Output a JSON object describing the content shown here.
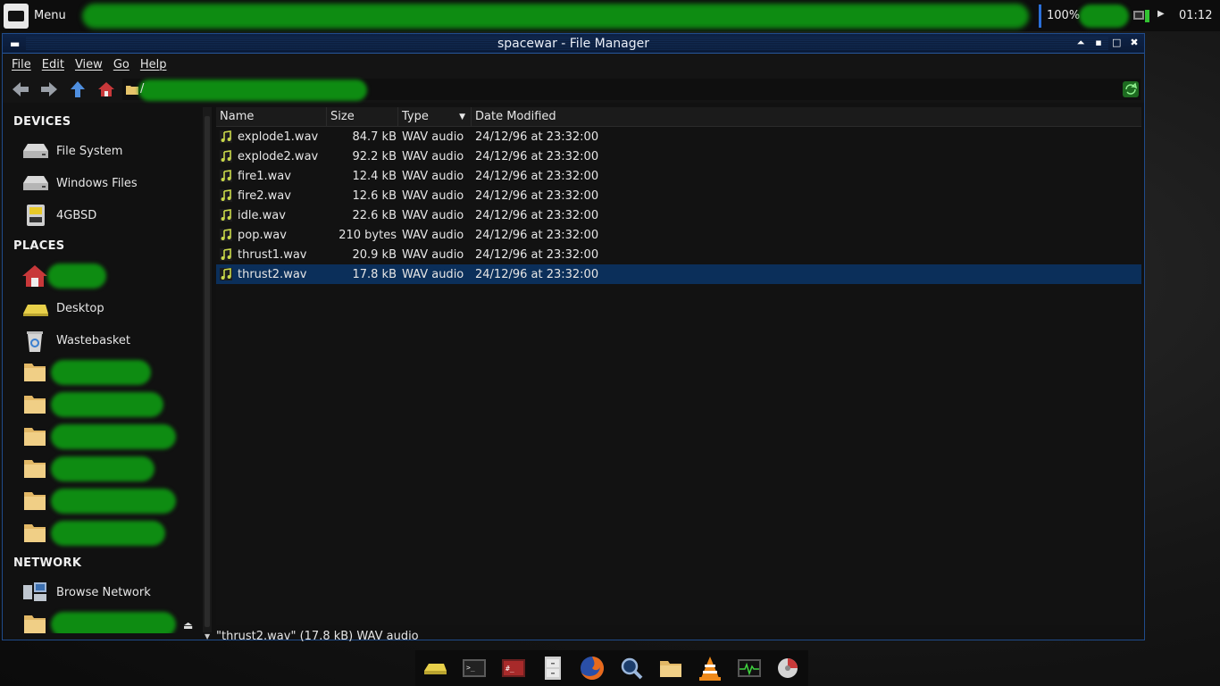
{
  "top_panel": {
    "menu_label": "Menu",
    "battery_percent": "100%",
    "clock": "01:12"
  },
  "window": {
    "title": "spacewar - File Manager",
    "menu": [
      "File",
      "Edit",
      "View",
      "Go",
      "Help"
    ],
    "location_path": "/"
  },
  "sidebar": {
    "devices_header": "DEVICES",
    "devices": [
      {
        "label": "File System",
        "icon": "drive-icon"
      },
      {
        "label": "Windows Files",
        "icon": "drive-icon"
      },
      {
        "label": "4GBSD",
        "icon": "sd-card-icon"
      }
    ],
    "places_header": "PLACES",
    "places": [
      {
        "label": "",
        "icon": "home-icon"
      },
      {
        "label": "Desktop",
        "icon": "desktop-icon"
      },
      {
        "label": "Wastebasket",
        "icon": "trash-icon"
      }
    ],
    "network_header": "NETWORK",
    "network": [
      {
        "label": "Browse Network",
        "icon": "network-icon"
      }
    ]
  },
  "columns": {
    "name": "Name",
    "size": "Size",
    "type": "Type",
    "date": "Date Modified"
  },
  "files": [
    {
      "name": "explode1.wav",
      "size": "84.7 kB",
      "type": "WAV audio",
      "date": "24/12/96 at 23:32:00"
    },
    {
      "name": "explode2.wav",
      "size": "92.2 kB",
      "type": "WAV audio",
      "date": "24/12/96 at 23:32:00"
    },
    {
      "name": "fire1.wav",
      "size": "12.4 kB",
      "type": "WAV audio",
      "date": "24/12/96 at 23:32:00"
    },
    {
      "name": "fire2.wav",
      "size": "12.6 kB",
      "type": "WAV audio",
      "date": "24/12/96 at 23:32:00"
    },
    {
      "name": "idle.wav",
      "size": "22.6 kB",
      "type": "WAV audio",
      "date": "24/12/96 at 23:32:00"
    },
    {
      "name": "pop.wav",
      "size": "210 bytes",
      "type": "WAV audio",
      "date": "24/12/96 at 23:32:00"
    },
    {
      "name": "thrust1.wav",
      "size": "20.9 kB",
      "type": "WAV audio",
      "date": "24/12/96 at 23:32:00"
    },
    {
      "name": "thrust2.wav",
      "size": "17.8 kB",
      "type": "WAV audio",
      "date": "24/12/96 at 23:32:00"
    }
  ],
  "selected_index": 7,
  "status": "\"thrust2.wav\" (17.8 kB) WAV audio",
  "dock": [
    "drive-icon",
    "terminal-icon",
    "root-terminal-icon",
    "file-cabinet-icon",
    "firefox-icon",
    "search-icon",
    "folder-icon",
    "vlc-icon",
    "system-monitor-icon",
    "disk-usage-icon"
  ],
  "colors": {
    "selection": "#0b2f5a",
    "titlebar": "#0e2347",
    "censor": "#0e8c12"
  }
}
